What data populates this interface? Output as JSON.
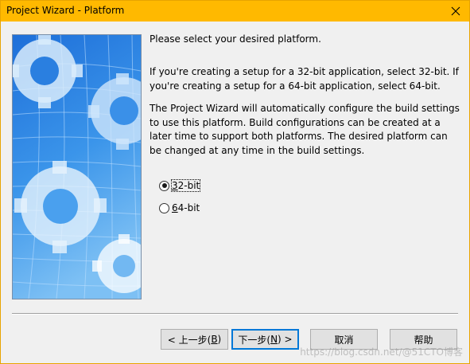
{
  "window": {
    "title": "Project Wizard - Platform",
    "close_glyph": "✕"
  },
  "content": {
    "intro": "Please select your desired platform.",
    "para2": "If you're creating a setup for a 32-bit application, select 32-bit. If you're creating a setup for a 64-bit application, select 64-bit.",
    "para3": "The Project Wizard will automatically configure the build settings to use this platform. Build configurations can be created at a later time to support both platforms. The desired platform can be changed at any time in the build settings."
  },
  "platform_options": [
    {
      "prefix": "",
      "accel": "3",
      "rest": "2-bit",
      "selected": true
    },
    {
      "prefix": "",
      "accel": "6",
      "rest": "4-bit",
      "selected": false
    }
  ],
  "buttons": {
    "back": {
      "pre": "< 上一步(",
      "accel": "B",
      "post": ")"
    },
    "next": {
      "pre": "下一步(",
      "accel": "N",
      "post": ") >"
    },
    "cancel": "取消",
    "help": "帮助"
  },
  "watermark": "https://blog.csdn.net/@51CTO博客",
  "colors": {
    "titlebar": "#ffb900",
    "accent": "#0078d7",
    "panel_blue": "#2f8ee6"
  }
}
